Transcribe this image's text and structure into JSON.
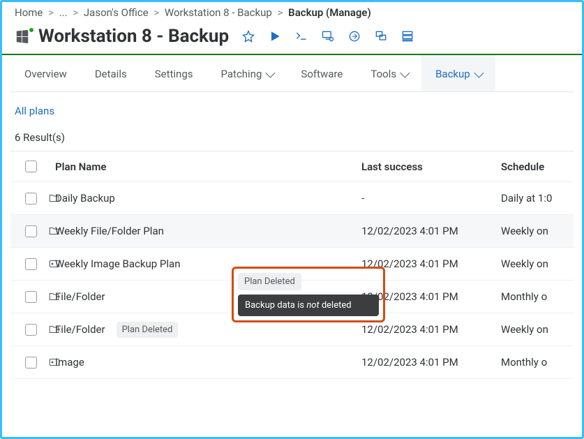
{
  "breadcrumbs": {
    "items": [
      "Home",
      "...",
      "Jason's Office",
      "Workstation 8 - Backup"
    ],
    "current": "Backup (Manage)"
  },
  "header": {
    "title": "Workstation 8 - Backup"
  },
  "tabs": {
    "items": [
      {
        "label": "Overview",
        "dropdown": false
      },
      {
        "label": "Details",
        "dropdown": false
      },
      {
        "label": "Settings",
        "dropdown": false
      },
      {
        "label": "Patching",
        "dropdown": true
      },
      {
        "label": "Software",
        "dropdown": false
      },
      {
        "label": "Tools",
        "dropdown": true
      },
      {
        "label": "Backup",
        "dropdown": true
      }
    ],
    "activeIndex": 6
  },
  "subnav": {
    "all_plans": "All plans"
  },
  "table": {
    "result_text": "6 Result(s)",
    "columns": {
      "plan": "Plan Name",
      "last": "Last success",
      "schedule": "Schedule"
    },
    "rows": [
      {
        "icon": "folder",
        "name": "Daily Backup",
        "deleted": false,
        "last": "-",
        "schedule": "Daily at 1:0"
      },
      {
        "icon": "folder",
        "name": "Weekly File/Folder Plan",
        "deleted": true,
        "last": "12/02/2023 4:01 PM",
        "schedule": "Weekly on",
        "highlight": true
      },
      {
        "icon": "image",
        "name": "Weekly Image Backup Plan",
        "deleted": true,
        "last": "12/02/2023 4:01 PM",
        "schedule": "Weekly on"
      },
      {
        "icon": "folder",
        "name": "File/Folder",
        "deleted": false,
        "last": "12/02/2023 4:01 PM",
        "schedule": "Monthly o"
      },
      {
        "icon": "folder",
        "name": "File/Folder",
        "deleted": true,
        "last": "12/02/2023 4:01 PM",
        "schedule": "Weekly on"
      },
      {
        "icon": "image",
        "name": "Image",
        "deleted": false,
        "last": "12/02/2023 4:01 PM",
        "schedule": "Monthly o"
      }
    ],
    "deleted_pill": "Plan Deleted"
  },
  "tooltip": {
    "pill": "Plan Deleted",
    "text_pre": "Backup data is ",
    "text_em": "not",
    "text_post": " deleted"
  }
}
